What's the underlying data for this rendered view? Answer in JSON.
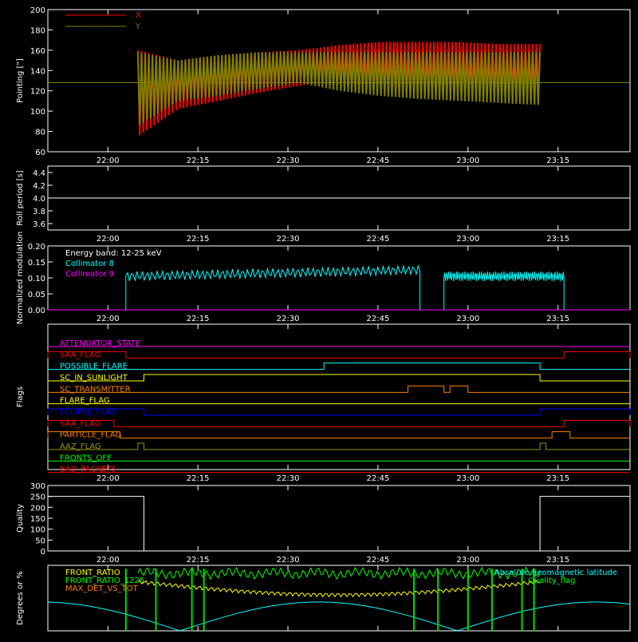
{
  "x_ticks": [
    "22:00",
    "22:15",
    "22:30",
    "22:45",
    "23:00",
    "23:15"
  ],
  "colors": {
    "x": "#ff0000",
    "y": "#808000",
    "white": "#ffffff",
    "cyan": "#00ffff",
    "magenta": "#ff00ff",
    "red": "#ff0000",
    "orange": "#ff7f00",
    "yellow": "#ffff00",
    "blue": "#0000ff",
    "olive": "#999900",
    "green": "#00ff00",
    "lightgreen": "#00dd00"
  },
  "chart_data": [
    {
      "type": "line",
      "ylabel": "Pointing [\"]",
      "ylim": [
        60,
        200
      ],
      "yticks": [
        "60",
        "80",
        "100",
        "120",
        "140",
        "160",
        "180",
        "200"
      ],
      "legend": [
        "X",
        "Y"
      ],
      "x_range": [
        "21:50",
        "23:27"
      ],
      "series": [
        {
          "name": "X",
          "color": "#ff0000",
          "values_envelope": {
            "start": "22:05",
            "end": "23:12",
            "low": [
              75,
              102,
              110,
              118,
              125,
              130,
              125,
              122,
              120,
              118,
              118
            ],
            "high": [
              160,
              150,
              155,
              158,
              160,
              165,
              168,
              168,
              168,
              166,
              166
            ]
          }
        },
        {
          "name": "Y",
          "color": "#808000",
          "values_envelope": {
            "start": "22:05",
            "end": "23:12",
            "low": [
              85,
              110,
              115,
              122,
              128,
              120,
              115,
              112,
              110,
              108,
              106
            ],
            "high": [
              158,
              150,
              155,
              158,
              158,
              158,
              158,
              158,
              158,
              158,
              158
            ]
          }
        }
      ],
      "baseline": 128
    },
    {
      "type": "line",
      "ylabel": "Roll period [s]",
      "ylim": [
        3.5,
        4.5
      ],
      "yticks": [
        "3.6",
        "3.8",
        "4.0",
        "4.2",
        "4.4"
      ],
      "series": [
        {
          "name": "",
          "values": [
            4.0
          ]
        }
      ]
    },
    {
      "type": "line",
      "ylabel": "Normalized modulation",
      "ylim": [
        0,
        0.2
      ],
      "yticks": [
        "0.00",
        "0.05",
        "0.10",
        "0.15",
        "0.20"
      ],
      "title": "Energy band: 12-25 keV",
      "legend": [
        "Collimator 8",
        "Collimator 9"
      ],
      "segments": [
        {
          "start": "22:03",
          "end": "22:52",
          "mean": 0.105
        },
        {
          "start": "22:56",
          "end": "23:16",
          "mean": 0.105
        }
      ]
    },
    {
      "type": "line",
      "ylabel": "Flags",
      "flags": [
        {
          "label": "ATTENUATOR_STATE",
          "color": "#ff00ff",
          "on": []
        },
        {
          "label": "SAA_FLAG",
          "color": "#ff0000",
          "on": [
            [
              "21:50",
              "22:03"
            ],
            [
              "23:16",
              "23:27"
            ]
          ]
        },
        {
          "label": "POSSIBLE_FLARE",
          "color": "#00ffff",
          "on": [
            [
              "22:36",
              "23:12"
            ]
          ]
        },
        {
          "label": "SC_IN_SUNLIGHT",
          "color": "#ffff00",
          "on": [
            [
              "22:06",
              "23:12"
            ]
          ]
        },
        {
          "label": "SC_TRANSMITTER",
          "color": "#ff7f00",
          "on": [
            [
              "22:50",
              "22:56"
            ],
            [
              "22:57",
              "23:00"
            ]
          ]
        },
        {
          "label": "FLARE_FLAG",
          "color": "#ffff00",
          "on": []
        },
        {
          "label": "ECLIPSE_FLAG",
          "color": "#0000ff",
          "on": [
            [
              "21:50",
              "22:06"
            ],
            [
              "23:12",
              "23:27"
            ]
          ]
        },
        {
          "label": "SAA_FLAG",
          "color": "#ff0000",
          "on": [
            [
              "21:50",
              "22:01"
            ],
            [
              "23:16",
              "23:27"
            ]
          ]
        },
        {
          "label": "PARTICLE_FLAG",
          "color": "#ff7f00",
          "on": [
            [
              "21:50",
              "22:02"
            ],
            [
              "23:14",
              "23:17"
            ]
          ]
        },
        {
          "label": "AAZ_FLAG",
          "color": "#999900",
          "on": [
            [
              "22:05",
              "22:06"
            ],
            [
              "23:12",
              "23:13"
            ]
          ]
        },
        {
          "label": "FRONTS_OFF",
          "color": "#00ff00",
          "on": []
        },
        {
          "label": "BAD_PACKETS",
          "color": "#ff0000",
          "on": []
        }
      ]
    },
    {
      "type": "line",
      "ylabel": "Quality",
      "ylim": [
        0,
        300
      ],
      "yticks": [
        "0",
        "50",
        "100",
        "150",
        "200",
        "250",
        "300"
      ],
      "series": [
        {
          "name": "",
          "values": [
            250,
            0,
            250
          ],
          "breaks": [
            "22:06",
            "23:12"
          ]
        }
      ]
    },
    {
      "type": "line",
      "ylabel": "Degrees or %",
      "ylim": [
        0,
        100
      ],
      "legend": [
        "FRONT_RATIO",
        "FRONT_RATIO_1225",
        "MAX_DET_VS_TOT",
        "Absolute geomagnetic latitude",
        "Quality_flag"
      ],
      "series": [
        {
          "name": "Absolute geomagnetic latitude",
          "values": [
            15,
            44,
            0,
            44,
            0,
            20
          ]
        }
      ]
    }
  ]
}
